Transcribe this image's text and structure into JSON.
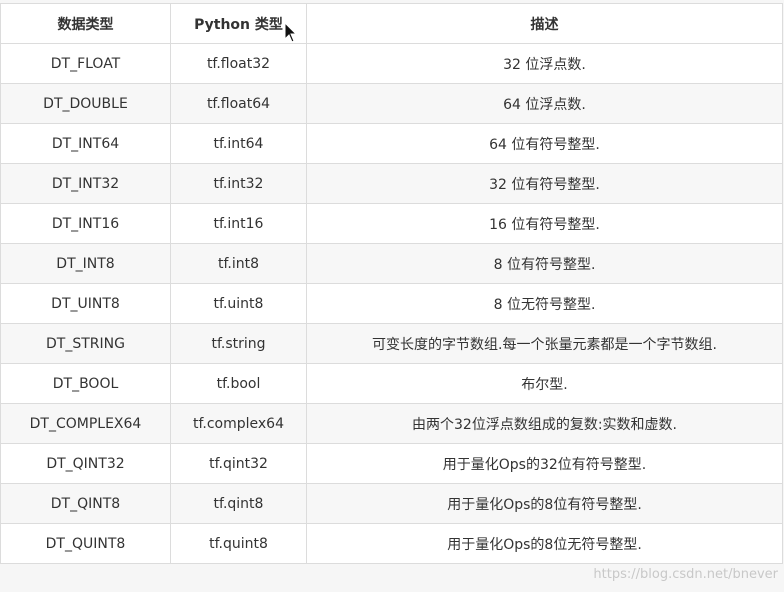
{
  "headers": [
    "数据类型",
    "Python 类型",
    "描述"
  ],
  "rows": [
    {
      "dtype": "DT_FLOAT",
      "python": "tf.float32",
      "desc": "32 位浮点数."
    },
    {
      "dtype": "DT_DOUBLE",
      "python": "tf.float64",
      "desc": "64 位浮点数."
    },
    {
      "dtype": "DT_INT64",
      "python": "tf.int64",
      "desc": "64 位有符号整型."
    },
    {
      "dtype": "DT_INT32",
      "python": "tf.int32",
      "desc": "32 位有符号整型."
    },
    {
      "dtype": "DT_INT16",
      "python": "tf.int16",
      "desc": "16 位有符号整型."
    },
    {
      "dtype": "DT_INT8",
      "python": "tf.int8",
      "desc": "8 位有符号整型."
    },
    {
      "dtype": "DT_UINT8",
      "python": "tf.uint8",
      "desc": "8 位无符号整型."
    },
    {
      "dtype": "DT_STRING",
      "python": "tf.string",
      "desc": "可变长度的字节数组.每一个张量元素都是一个字节数组."
    },
    {
      "dtype": "DT_BOOL",
      "python": "tf.bool",
      "desc": "布尔型."
    },
    {
      "dtype": "DT_COMPLEX64",
      "python": "tf.complex64",
      "desc": "由两个32位浮点数组成的复数:实数和虚数."
    },
    {
      "dtype": "DT_QINT32",
      "python": "tf.qint32",
      "desc": "用于量化Ops的32位有符号整型."
    },
    {
      "dtype": "DT_QINT8",
      "python": "tf.qint8",
      "desc": "用于量化Ops的8位有符号整型."
    },
    {
      "dtype": "DT_QUINT8",
      "python": "tf.quint8",
      "desc": "用于量化Ops的8位无符号整型."
    }
  ],
  "watermark": "https://blog.csdn.net/bnever",
  "icons": {
    "cursor": "mouse-pointer-icon"
  }
}
